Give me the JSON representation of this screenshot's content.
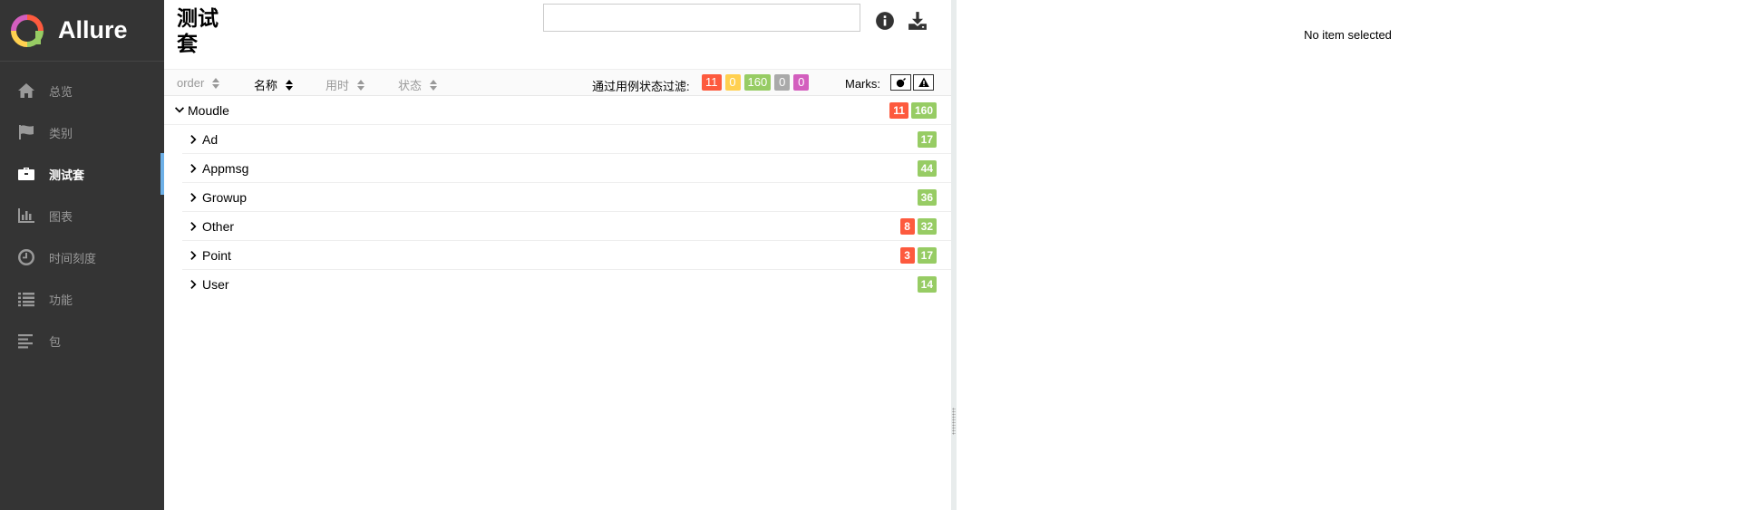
{
  "brand": {
    "name": "Allure"
  },
  "sidebar": {
    "items": [
      {
        "label": "总览",
        "icon": "home-icon",
        "active": false
      },
      {
        "label": "类别",
        "icon": "flag-icon",
        "active": false
      },
      {
        "label": "测试套",
        "icon": "briefcase-icon",
        "active": true
      },
      {
        "label": "图表",
        "icon": "bar-chart-icon",
        "active": false
      },
      {
        "label": "时间刻度",
        "icon": "clock-icon",
        "active": false
      },
      {
        "label": "功能",
        "icon": "list-icon",
        "active": false
      },
      {
        "label": "包",
        "icon": "align-left-icon",
        "active": false
      }
    ]
  },
  "tree_pane": {
    "title": "测试套",
    "search": {
      "value": "",
      "placeholder": ""
    },
    "info_icon": "info-icon",
    "download_icon": "download-icon",
    "sorters": [
      {
        "label": "order",
        "active": false
      },
      {
        "label": "名称",
        "active": true
      },
      {
        "label": "用时",
        "active": false
      },
      {
        "label": "状态",
        "active": false
      }
    ],
    "filter_label": "通过用例状态过滤:",
    "filters": [
      {
        "status": "failed",
        "count": "11"
      },
      {
        "status": "broken",
        "count": "0"
      },
      {
        "status": "passed",
        "count": "160"
      },
      {
        "status": "skipped",
        "count": "0"
      },
      {
        "status": "unknown",
        "count": "0"
      }
    ],
    "marks_label": "Marks:",
    "mark_icons": [
      "bomb-icon",
      "warning-icon"
    ],
    "tree": {
      "root": {
        "name": "Moudle",
        "failed": "11",
        "passed": "160"
      },
      "children": [
        {
          "name": "Ad",
          "failed": "",
          "passed": "17"
        },
        {
          "name": "Appmsg",
          "failed": "",
          "passed": "44"
        },
        {
          "name": "Growup",
          "failed": "",
          "passed": "36"
        },
        {
          "name": "Other",
          "failed": "8",
          "passed": "32"
        },
        {
          "name": "Point",
          "failed": "3",
          "passed": "17"
        },
        {
          "name": "User",
          "failed": "",
          "passed": "14"
        }
      ]
    }
  },
  "details_pane": {
    "empty_message": "No item selected"
  },
  "colors": {
    "sidebar_bg": "#343434",
    "accent": "#6eb0e7",
    "failed": "#fd5a3e",
    "broken": "#ffd050",
    "passed": "#97cc64",
    "skipped": "#aaaaaa",
    "unknown": "#d35ebe"
  }
}
